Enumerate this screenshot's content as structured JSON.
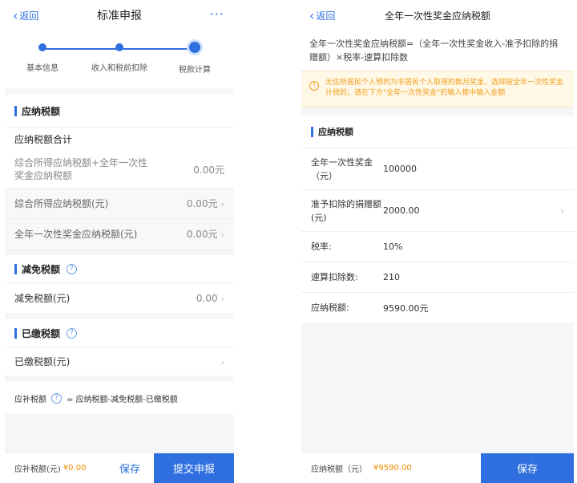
{
  "left": {
    "back_label": "返回",
    "title": "标准申报",
    "more_label": "···",
    "steps": [
      "基本信息",
      "收入和税前扣除",
      "税款计算"
    ],
    "tax_due": {
      "heading": "应纳税额",
      "total_label": "应纳税额合计",
      "combined_label": "综合所得应纳税额+全年一次性奖金应纳税额",
      "combined_value": "0.00元",
      "comprehensive_label": "综合所得应纳税额(元)",
      "comprehensive_value": "0.00元",
      "bonus_label": "全年一次性奖金应纳税额(元)",
      "bonus_value": "0.00元"
    },
    "relief": {
      "heading": "减免税额",
      "label": "减免税额(元)",
      "value": "0.00"
    },
    "paid": {
      "heading": "已缴税额",
      "label": "已缴税额(元)"
    },
    "formula": {
      "label": "应补税额",
      "text": "= 应纳税额-减免税额-已缴税额"
    },
    "footer": {
      "sum_label": "应补税额(元)",
      "sum_value": "¥0.00",
      "save_label": "保存",
      "submit_label": "提交申报"
    }
  },
  "right": {
    "back_label": "返回",
    "title": "全年一次性奖金应纳税额",
    "description": "全年一次性奖金应纳税额=（全年一次性奖金收入-准予扣除的捐赠额）×税率-速算扣除数",
    "notice": "无住所居民个人预判为非居民个人取得的数月奖金，选择按全年一次性奖金计税的，请在下方\"全年一次性奖金\"的输入框中输入金额",
    "heading": "应纳税额",
    "fields": [
      {
        "label": "全年一次性奖金（元）",
        "value": "100000"
      },
      {
        "label": "准予扣除的捐赠额(元)",
        "value": "2000.00"
      },
      {
        "label": "税率:",
        "value": "10%"
      },
      {
        "label": "速算扣除数:",
        "value": "210"
      },
      {
        "label": "应纳税额:",
        "value": "9590.00元"
      }
    ],
    "footer": {
      "sum_label": "应纳税额（元）",
      "sum_value": "¥9590.00",
      "save_label": "保存"
    }
  },
  "colors": {
    "accent": "#2f6fe0",
    "warning": "#f0a020",
    "amount": "#f08a00"
  }
}
